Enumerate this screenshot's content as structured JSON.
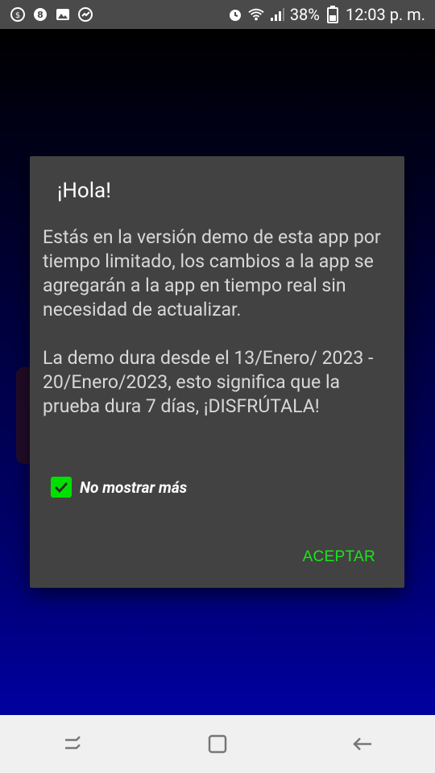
{
  "status_bar": {
    "left_icons": [
      "vpn-icon",
      "badge-8-icon",
      "image-icon",
      "speedometer-icon"
    ],
    "alarm_icon": "alarm-icon",
    "wifi_icon": "wifi-icon",
    "signal_icon": "signal-icon",
    "battery": "38%",
    "battery_icon": "battery-icon",
    "time": "12:03 p. m."
  },
  "dialog": {
    "title": "¡Hola!",
    "message": "Estás en la versión demo de esta app por tiempo limitado, los cambios a la app se agregarán a la app en tiempo real sin necesidad de actualizar.\n\nLa demo dura desde el 13/Enero/ 2023 - 20/Enero/2023, esto significa que la prueba dura 7 días, ¡DISFRÚTALA!",
    "checkbox_label": "No mostrar más",
    "checkbox_checked": true,
    "accept_label": "ACEPTAR",
    "accent_color": "#19e619"
  },
  "nav_bar": {
    "buttons": [
      "recent-apps-icon",
      "home-icon",
      "back-icon"
    ]
  }
}
